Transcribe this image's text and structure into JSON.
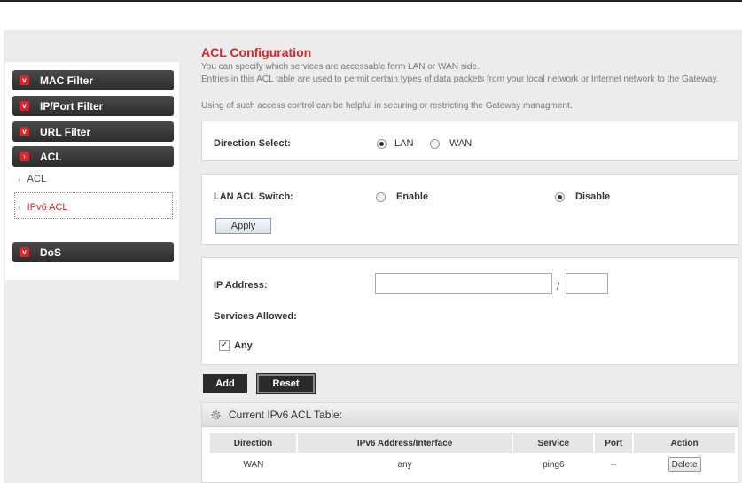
{
  "sidebar": {
    "menu": [
      {
        "label": "MAC Filter"
      },
      {
        "label": "IP/Port Filter"
      },
      {
        "label": "URL Filter"
      },
      {
        "label": "ACL"
      },
      {
        "label": "DoS"
      }
    ],
    "subitems": [
      {
        "label": "ACL"
      },
      {
        "label": "IPv6 ACL",
        "active": true
      }
    ]
  },
  "header": {
    "title": "ACL Configuration",
    "desc1": "You can specify which services are accessable form LAN or WAN side.",
    "desc2": "Entries in this ACL table are used to permit certain types of data packets from your local network or Internet network to the Gateway.",
    "desc3": "Using of such access control can be helpful in securing or restricting the Gateway managment."
  },
  "direction": {
    "label": "Direction Select:",
    "options": [
      "LAN",
      "WAN"
    ],
    "selected": "LAN"
  },
  "switch": {
    "label": "LAN ACL Switch:",
    "enable_label": "Enable",
    "disable_label": "Disable",
    "selected": "Disable",
    "apply_label": "Apply"
  },
  "form": {
    "ip_label": "IP Address:",
    "ip_value": "",
    "prefix_value": "",
    "slash": "/",
    "services_label": "Services Allowed:",
    "any_label": "Any",
    "any_checked": true,
    "add_label": "Add",
    "reset_label": "Reset"
  },
  "table": {
    "title": "Current IPv6 ACL Table:",
    "columns": [
      "Direction",
      "IPv6 Address/Interface",
      "Service",
      "Port",
      "Action"
    ],
    "rows": [
      {
        "direction": "WAN",
        "address": "any",
        "service": "ping6",
        "port": "--",
        "action": "Delete"
      }
    ]
  },
  "colors": {
    "accent": "#d7262c",
    "menu_bg": "#2c2c2c"
  }
}
